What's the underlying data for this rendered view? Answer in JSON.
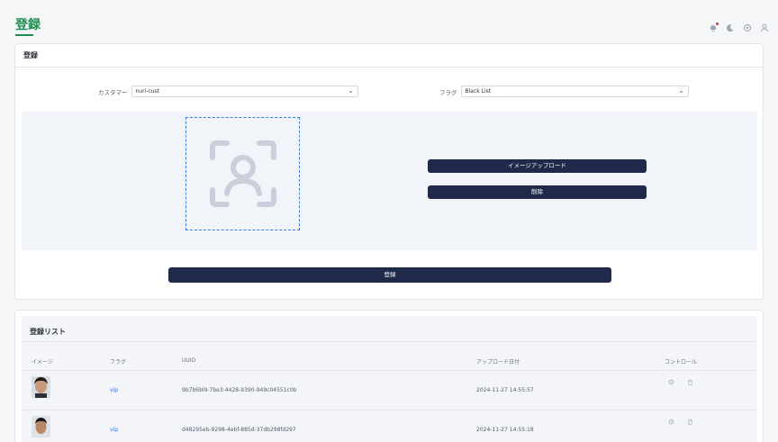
{
  "page": {
    "title": "登録"
  },
  "topbar": {
    "icons": [
      "notification-icon",
      "moon-icon",
      "settings-icon",
      "user-icon"
    ]
  },
  "register": {
    "header": "登録",
    "customer_label": "カスタマー",
    "customer_value": "nuri-cust",
    "flag_label": "フラグ",
    "flag_value": "Black List",
    "upload_label": "イメージアップロード",
    "delete_label": "削除",
    "submit_label": "登録"
  },
  "list": {
    "title": "登録リスト",
    "columns": [
      "イメージ",
      "フラグ",
      "UUID",
      "アップロード日付",
      "コントロール"
    ],
    "rows": [
      {
        "flag": "vip",
        "uuid": "9b7b6bl9-7be3-4428-9390-949c04551c0b",
        "uploaded": "2024-11-27 14:55:57"
      },
      {
        "flag": "vip",
        "uuid": "d48295eb-9298-4ebf-885d-37db298fd297",
        "uploaded": "2024-11-27 14:55:18"
      }
    ]
  },
  "colors": {
    "accent": "#1e8c4e",
    "button": "#1f2a4b",
    "dashed": "#3b7de0",
    "flag": "#2f6fd6"
  }
}
